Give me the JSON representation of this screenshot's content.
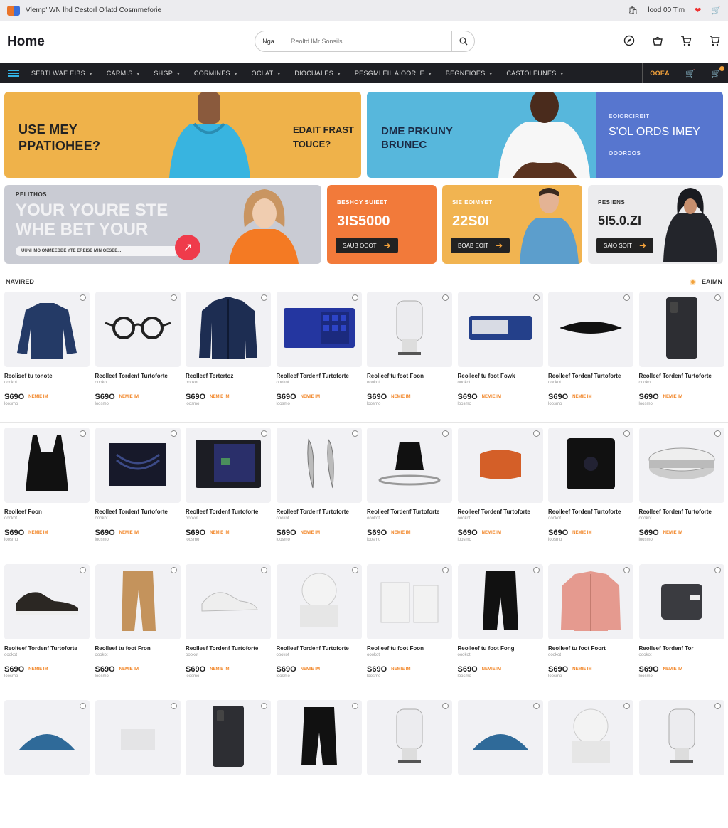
{
  "topbar": {
    "text": "Vlemp' WN lhd Cestorl O'latd Cosmmeforie",
    "account": "lood 00 Tim"
  },
  "header": {
    "title": "Home",
    "search_scope": "Nga",
    "search_placeholder": "Reoltd lMr Sonsils."
  },
  "nav": {
    "items": [
      "SEBTI WAE EIBS",
      "CARMIS",
      "SHGP",
      "CORMINES",
      "OCLAT",
      "DIOCUALES",
      "PESGMI EIL AIOORLE",
      "BEGNEIOES",
      "CASTOLEUNES"
    ],
    "deal": "OOEA"
  },
  "banners": {
    "b1": {
      "left": "USE MEY PPATIOHEE?",
      "right": "EDAIT FRAST TOUCE?"
    },
    "b2": {
      "left": "DME PRKUNY BRUNEC",
      "kicker": "EOIORCIREIT",
      "right": "S'OL ORDS IMEY",
      "sub": "OOORDOS"
    },
    "b3": {
      "kicker": "PELITHOS",
      "headline1": "YOUR YOURE STE",
      "headline2": "WHE BET YOUR",
      "foot": "UUNHMO ONMEEBBE YTE EREISE MIN OESEE..."
    },
    "b4": {
      "kicker": "BESHOY SUIEET",
      "price": "3IS5000",
      "cta": "SAUB OOOT"
    },
    "b5": {
      "kicker": "SIE EOIMYET",
      "price": "22S0I",
      "cta": "BOAB EOIT"
    },
    "b6": {
      "kicker": "PESIENS",
      "price": "5I5.0.ZI",
      "cta": "SAIO SOIT"
    }
  },
  "section": {
    "title": "NAVIRED",
    "right": "EAIMN"
  },
  "products": [
    [
      {
        "name": "Reolisef tu tonote",
        "icon": "sweater-icon"
      },
      {
        "name": "Reolleef Tordenf Turtoforte",
        "icon": "glasses-icon"
      },
      {
        "name": "Reolleef Tortertoz",
        "icon": "jacket-icon"
      },
      {
        "name": "Reolleef Tordenf Turtoforte",
        "icon": "tablet-icon"
      },
      {
        "name": "Reolleef tu foot Foon",
        "icon": "device-icon"
      },
      {
        "name": "Reolleef tu foot Fowk",
        "icon": "box-icon"
      },
      {
        "name": "Reolleef Tordenf Turtoforte",
        "icon": "mat-icon"
      },
      {
        "name": "Reolleef Tordenf Turtoforte",
        "icon": "phone-icon"
      }
    ],
    [
      {
        "name": "Reolleef Foon",
        "icon": "tanktop-icon"
      },
      {
        "name": "Reolleef Tordenf Turtoforte",
        "icon": "speaker-icon"
      },
      {
        "name": "Reolleef Tordenf Turtoforte",
        "icon": "screen-icon"
      },
      {
        "name": "Reolleef Tordenf Turtoforte",
        "icon": "tool-icon"
      },
      {
        "name": "Reolleef Tordenf Turtoforte",
        "icon": "lamp-icon"
      },
      {
        "name": "Reolleef Tordenf Turtoforte",
        "icon": "cushion-icon"
      },
      {
        "name": "Reolleef Tordenf Turtoforte",
        "icon": "tile-icon"
      },
      {
        "name": "Reolleef Tordenf Turtoforte",
        "icon": "ring-icon"
      }
    ],
    [
      {
        "name": "Reolteef Tordenf Turtoforte",
        "icon": "sneaker-icon"
      },
      {
        "name": "Reolleef tu foot Fron",
        "icon": "pants-icon"
      },
      {
        "name": "Reolleef Tordenf Turtoforte",
        "icon": "shoe-icon"
      },
      {
        "name": "Reolleef Tordenf Turtoforte",
        "icon": "dome-icon"
      },
      {
        "name": "Reolleef tu foot Foon",
        "icon": "cylinder-icon"
      },
      {
        "name": "Reolleef tu foot Fong",
        "icon": "shorts-icon"
      },
      {
        "name": "Reolleef tu foot Foort",
        "icon": "coat-icon"
      },
      {
        "name": "Reolleef Tordenf Tor",
        "icon": "camera-icon"
      }
    ]
  ],
  "product_common": {
    "price": "S69O",
    "promo": "NEMIE IM",
    "sub": "oookot",
    "rate": "loosmo"
  },
  "colors": {
    "accent": "#f2a13a",
    "nav_bg": "#1e1f24",
    "promo": "#f2872a"
  }
}
